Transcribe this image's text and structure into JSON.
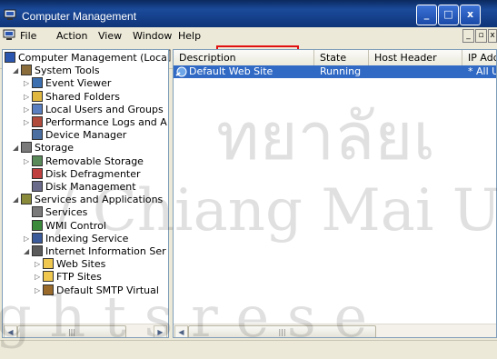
{
  "window": {
    "title": "Computer Management"
  },
  "menu": [
    "File",
    "Action",
    "View",
    "Window",
    "Help"
  ],
  "tree": [
    {
      "label": "Computer Management (Local)",
      "level": 0,
      "icon": "computer-icon"
    },
    {
      "label": "System Tools",
      "level": 1,
      "icon": "tools-icon"
    },
    {
      "label": "Event Viewer",
      "level": 2,
      "icon": "event-viewer-icon"
    },
    {
      "label": "Shared Folders",
      "level": 2,
      "icon": "shared-folders-icon"
    },
    {
      "label": "Local Users and Groups",
      "level": 2,
      "icon": "users-icon"
    },
    {
      "label": "Performance Logs and A",
      "level": 2,
      "icon": "performance-icon"
    },
    {
      "label": "Device Manager",
      "level": 2,
      "icon": "device-manager-icon"
    },
    {
      "label": "Storage",
      "level": 1,
      "icon": "storage-icon"
    },
    {
      "label": "Removable Storage",
      "level": 2,
      "icon": "removable-storage-icon"
    },
    {
      "label": "Disk Defragmenter",
      "level": 2,
      "icon": "defrag-icon"
    },
    {
      "label": "Disk Management",
      "level": 2,
      "icon": "disk-management-icon"
    },
    {
      "label": "Services and Applications",
      "level": 1,
      "icon": "services-apps-icon"
    },
    {
      "label": "Services",
      "level": 2,
      "icon": "services-icon"
    },
    {
      "label": "WMI Control",
      "level": 2,
      "icon": "wmi-icon"
    },
    {
      "label": "Indexing Service",
      "level": 2,
      "icon": "indexing-icon"
    },
    {
      "label": "Internet Information Ser",
      "level": 2,
      "icon": "iis-icon"
    },
    {
      "label": "Web Sites",
      "level": 3,
      "icon": "folder-icon"
    },
    {
      "label": "FTP Sites",
      "level": 3,
      "icon": "folder-icon"
    },
    {
      "label": "Default SMTP Virtual",
      "level": 3,
      "icon": "smtp-icon"
    }
  ],
  "columns": [
    "Description",
    "State",
    "Host Header Name",
    "IP Add"
  ],
  "rows": [
    {
      "description": "Default Web Site",
      "state": "Running",
      "host": "",
      "ip": "* All Ur"
    }
  ],
  "watermark": {
    "line1": "ทยาลัยเ",
    "line2": "/ Chiang Mai U",
    "line3": "g h t s   r e s e"
  },
  "colors": {
    "selection": "#316ac5",
    "titlebar": "#0f3478",
    "highlight_box": "#e01010"
  }
}
